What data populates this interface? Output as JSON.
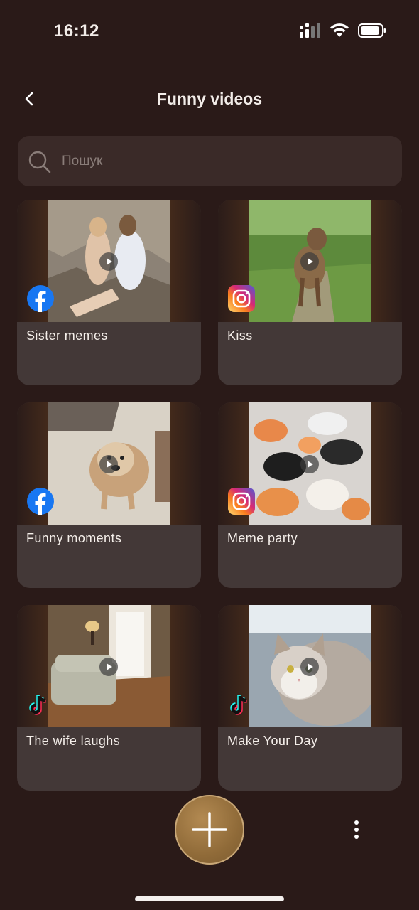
{
  "status_bar": {
    "time": "16:12"
  },
  "header": {
    "title": "Funny videos"
  },
  "search": {
    "placeholder": "Пошук"
  },
  "cards": [
    {
      "label": "Sister memes",
      "source": "facebook",
      "thumb": "sister-photo"
    },
    {
      "label": "Kiss",
      "source": "instagram",
      "thumb": "dog-photo"
    },
    {
      "label": "Funny moments",
      "source": "facebook",
      "thumb": "spaniel-photo"
    },
    {
      "label": "Meme party",
      "source": "instagram",
      "thumb": "cats-photo"
    },
    {
      "label": "The wife laughs",
      "source": "tiktok",
      "thumb": "room-photo"
    },
    {
      "label": "Make Your Day",
      "source": "tiktok",
      "thumb": "kitten-photo"
    }
  ],
  "colors": {
    "background": "#2a1a18",
    "card": "#433837",
    "accent": "#8f6a38"
  }
}
